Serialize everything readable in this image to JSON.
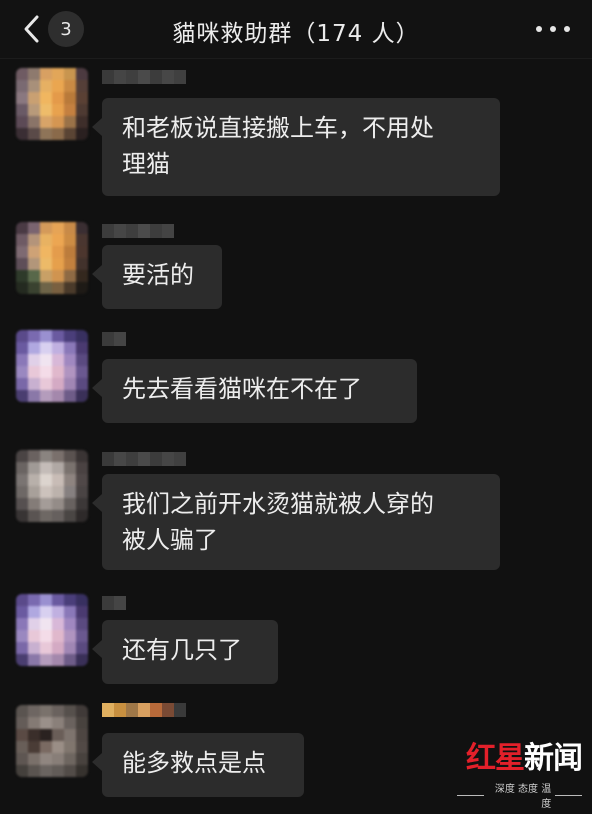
{
  "header": {
    "back_icon": "chevron-left-icon",
    "unread_count": "3",
    "title": "貓咪救助群（174 人）",
    "more_icon": "more-dots-icon"
  },
  "messages": [
    {
      "text": "和老板说直接搬上车，不用处\n理猫"
    },
    {
      "text": "要活的"
    },
    {
      "text": "先去看看猫咪在不在了"
    },
    {
      "text": "我们之前开水烫猫就被人穿的\n被人骗了"
    },
    {
      "text": "还有几只了"
    },
    {
      "text": "能多救点是点"
    }
  ],
  "watermark": {
    "brand_red": "红星",
    "brand_white": "新闻",
    "tagline": "深度 态度 温度",
    "colors": {
      "red": "#e3202a"
    }
  }
}
